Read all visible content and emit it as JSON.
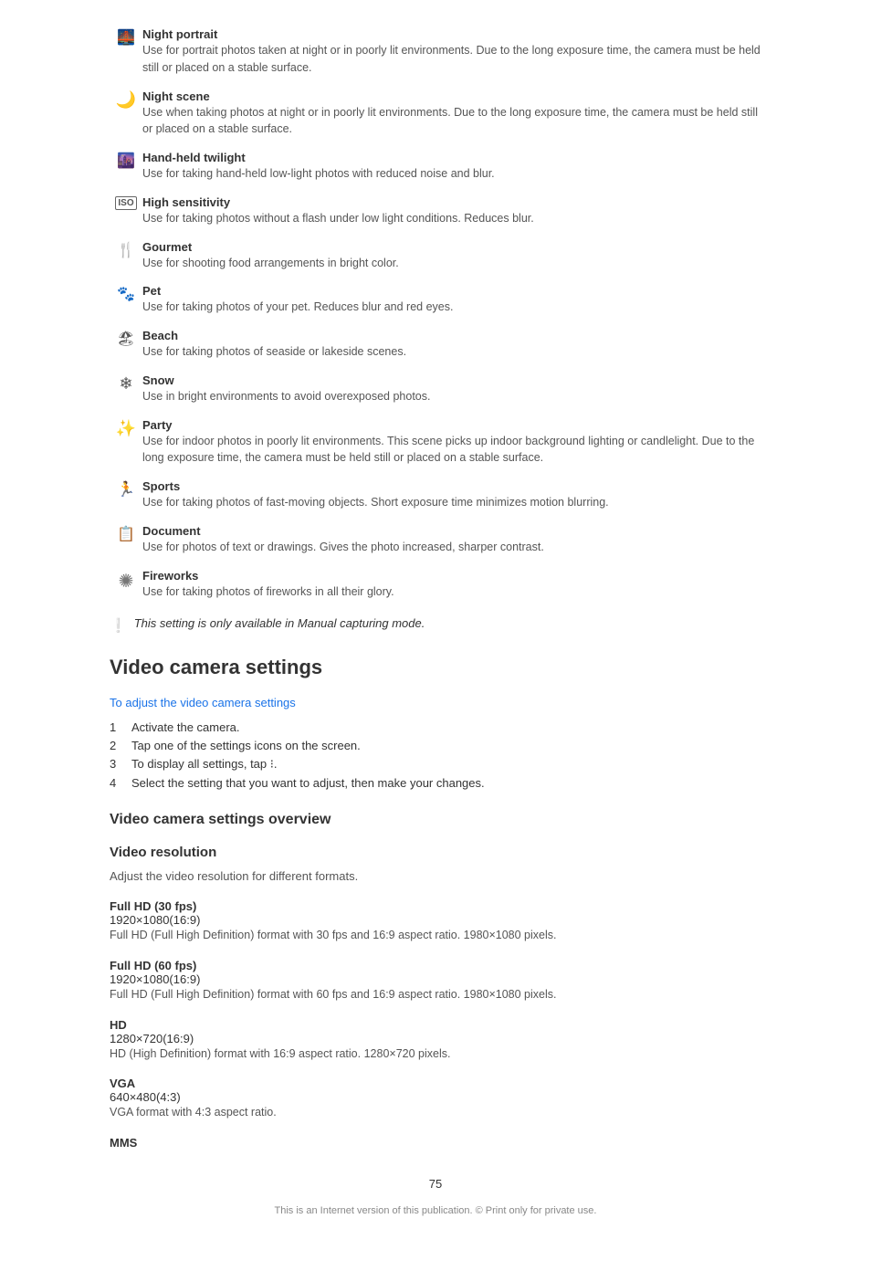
{
  "scenes": [
    {
      "icon": "👤✦",
      "icon_unicode": "🌃",
      "icon_text": "Night portrait",
      "title": "Night portrait",
      "desc": "Use for portrait photos taken at night or in poorly lit environments. Due to the long exposure time, the camera must be held still or placed on a stable surface."
    },
    {
      "icon_text": "Night scene",
      "icon_unicode": "🌙",
      "title": "Night scene",
      "desc": "Use when taking photos at night or in poorly lit environments. Due to the long exposure time, the camera must be held still or placed on a stable surface."
    },
    {
      "icon_text": "Hand-held twilight",
      "icon_unicode": "🌆",
      "title": "Hand-held twilight",
      "desc": "Use for taking hand-held low-light photos with reduced noise and blur."
    },
    {
      "icon_text": "High sensitivity",
      "icon_unicode": "ISO",
      "title": "High sensitivity",
      "desc": "Use for taking photos without a flash under low light conditions. Reduces blur."
    },
    {
      "icon_text": "Gourmet",
      "icon_unicode": "🍽",
      "title": "Gourmet",
      "desc": "Use for shooting food arrangements in bright color."
    },
    {
      "icon_text": "Pet",
      "icon_unicode": "🐾",
      "title": "Pet",
      "desc": "Use for taking photos of your pet. Reduces blur and red eyes."
    },
    {
      "icon_text": "Beach",
      "icon_unicode": "🏖",
      "title": "Beach",
      "desc": "Use for taking photos of seaside or lakeside scenes."
    },
    {
      "icon_text": "Snow",
      "icon_unicode": "❄",
      "title": "Snow",
      "desc": "Use in bright environments to avoid overexposed photos."
    },
    {
      "icon_text": "Party",
      "icon_unicode": "🎉",
      "title": "Party",
      "desc": "Use for indoor photos in poorly lit environments. This scene picks up indoor background lighting or candlelight. Due to the long exposure time, the camera must be held still or placed on a stable surface."
    },
    {
      "icon_text": "Sports",
      "icon_unicode": "🏃",
      "title": "Sports",
      "desc": "Use for taking photos of fast-moving objects. Short exposure time minimizes motion blurring."
    },
    {
      "icon_text": "Document",
      "icon_unicode": "📄",
      "title": "Document",
      "desc": "Use for photos of text or drawings. Gives the photo increased, sharper contrast."
    },
    {
      "icon_text": "Fireworks",
      "icon_unicode": "🎆",
      "title": "Fireworks",
      "desc": "Use for taking photos of fireworks in all their glory."
    }
  ],
  "note": {
    "icon": "❕",
    "text": "This setting is only available in Manual capturing mode."
  },
  "video_section": {
    "heading": "Video camera settings",
    "link": "To adjust the video camera settings",
    "steps": [
      {
        "num": "1",
        "text": "Activate the camera."
      },
      {
        "num": "2",
        "text": "Tap one of the settings icons on the screen."
      },
      {
        "num": "3",
        "text": "To display all settings, tap ⁝."
      },
      {
        "num": "4",
        "text": "Select the setting that you want to adjust, then make your changes."
      }
    ]
  },
  "overview_section": {
    "heading": "Video camera settings overview"
  },
  "resolution_section": {
    "heading": "Video resolution",
    "desc": "Adjust the video resolution for different formats.",
    "items": [
      {
        "label": "Full HD (30 fps)",
        "sublabel": "1920×1080(16:9)",
        "desc": "Full HD (Full High Definition) format with 30 fps and 16:9 aspect ratio. 1980×1080 pixels."
      },
      {
        "label": "Full HD (60 fps)",
        "sublabel": "1920×1080(16:9)",
        "desc": "Full HD (Full High Definition) format with 60 fps and 16:9 aspect ratio. 1980×1080 pixels."
      },
      {
        "label": "HD",
        "sublabel": "1280×720(16:9)",
        "desc": "HD (High Definition) format with 16:9 aspect ratio. 1280×720 pixels."
      },
      {
        "label": "VGA",
        "sublabel": "640×480(4:3)",
        "desc": "VGA format with 4:3 aspect ratio."
      },
      {
        "label": "MMS",
        "sublabel": "",
        "desc": ""
      }
    ]
  },
  "page_number": "75",
  "footer": "This is an Internet version of this publication. © Print only for private use."
}
